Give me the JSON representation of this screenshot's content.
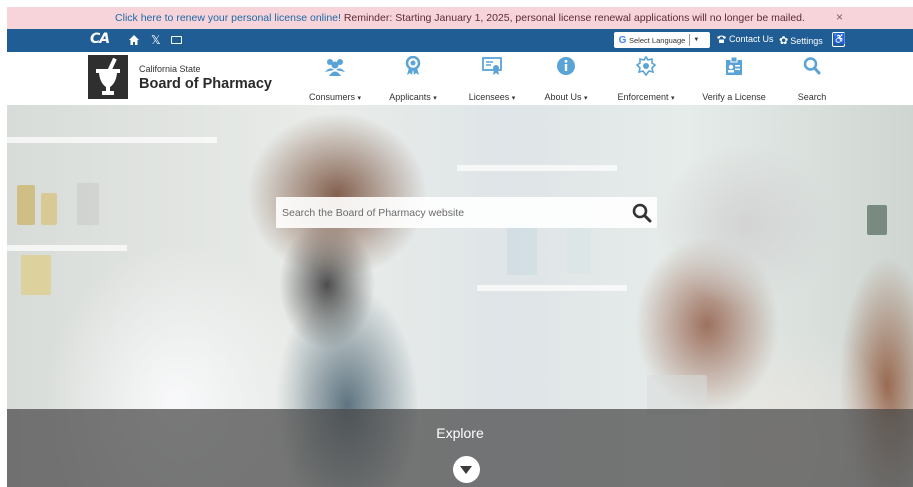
{
  "alert": {
    "link_text": "Click here to renew your personal license online!",
    "message": " Reminder: Starting January 1, 2025, personal license renewal applications will no longer be mailed.",
    "close": "×"
  },
  "utility": {
    "ca_logo": "CA",
    "language": "Select Language",
    "language_caret": "▼",
    "contact": "Contact Us",
    "settings": "Settings"
  },
  "brand": {
    "state": "California State",
    "name": "Board of Pharmacy"
  },
  "nav": [
    {
      "label": "Consumers",
      "dropdown": true,
      "icon": "consumers-icon"
    },
    {
      "label": "Applicants",
      "dropdown": true,
      "icon": "applicants-icon"
    },
    {
      "label": "Licensees",
      "dropdown": true,
      "icon": "licensees-icon"
    },
    {
      "label": "About Us",
      "dropdown": true,
      "icon": "info-icon"
    },
    {
      "label": "Enforcement",
      "dropdown": true,
      "icon": "badge-icon"
    },
    {
      "label": "Verify a License",
      "dropdown": false,
      "icon": "id-card-icon"
    },
    {
      "label": "Search",
      "dropdown": false,
      "icon": "search-icon"
    }
  ],
  "colors": {
    "utility_bar": "#1f5d94",
    "nav_icon": "#5aa3d6",
    "alert_bg": "#f7d4d9"
  },
  "hero": {
    "search_placeholder": "Search the Board of Pharmacy website",
    "explore": "Explore"
  }
}
